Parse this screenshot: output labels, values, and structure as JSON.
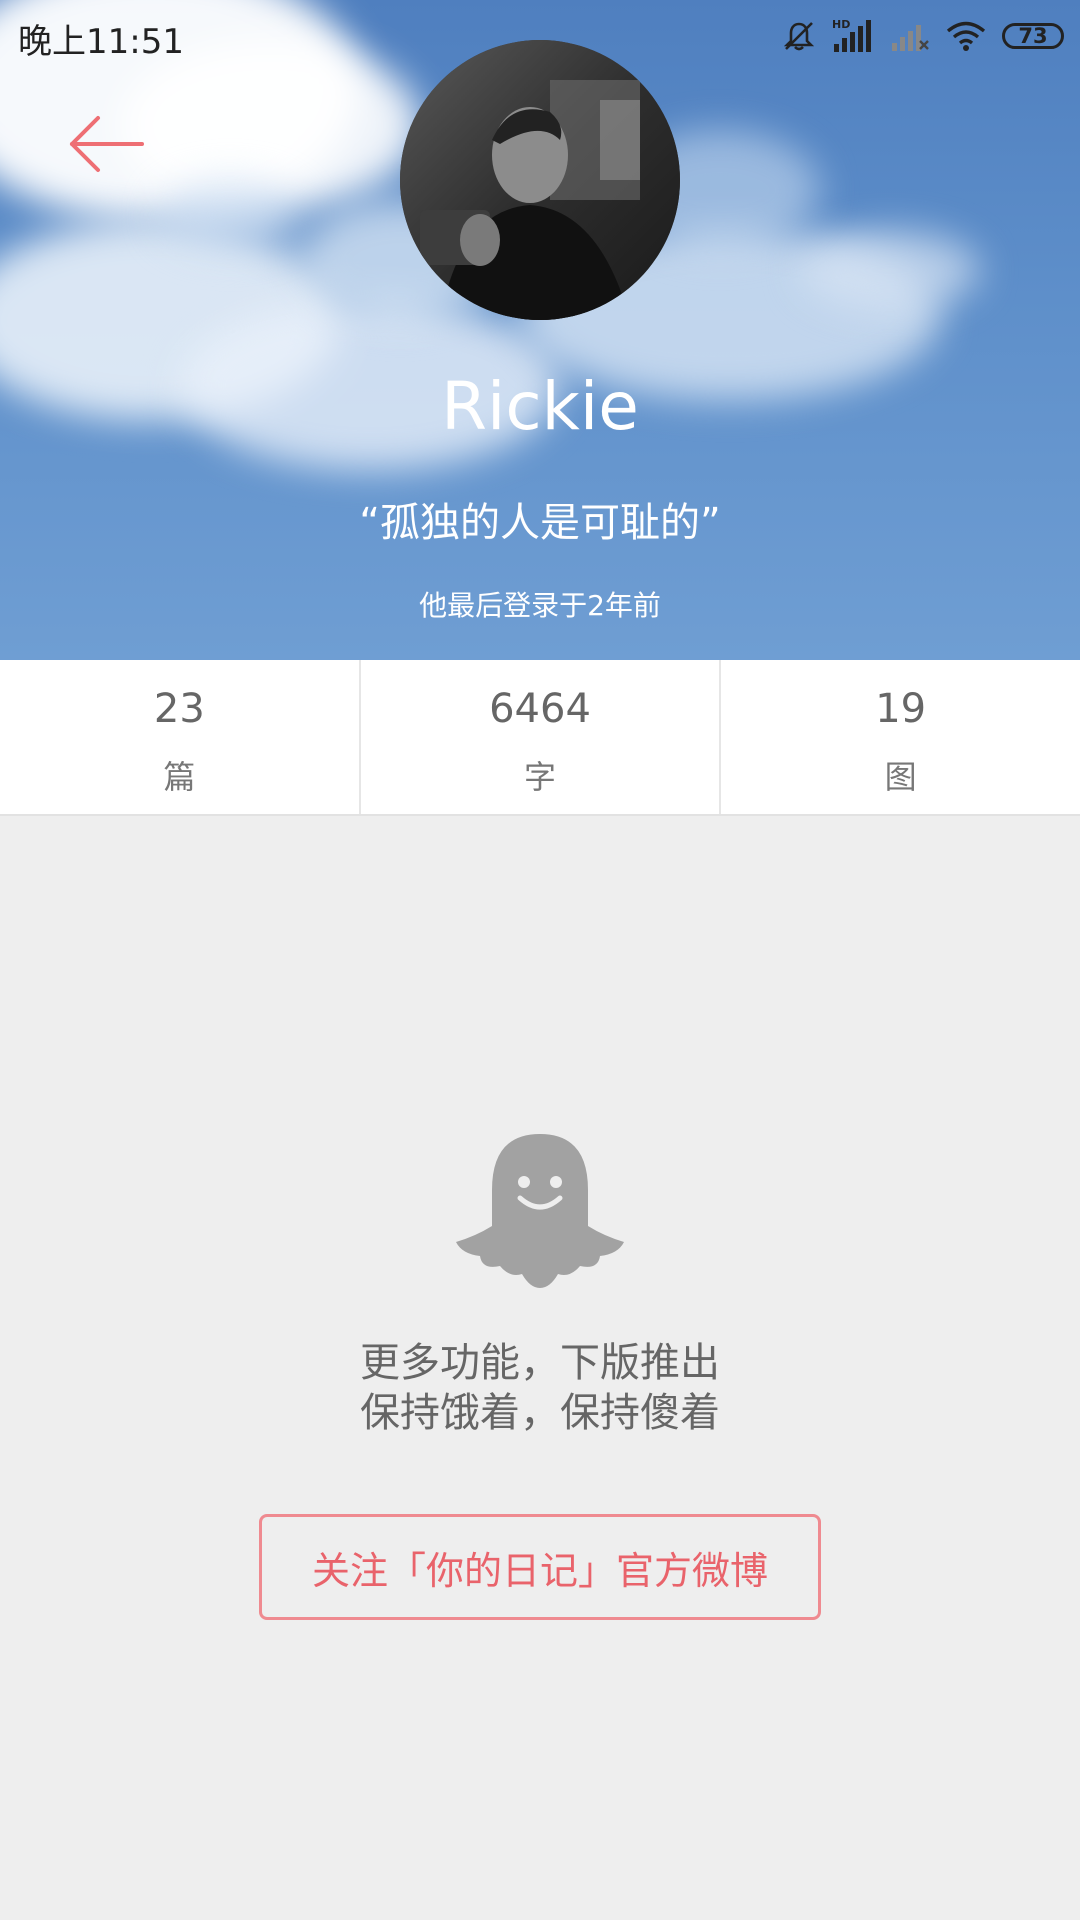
{
  "status_bar": {
    "time": "晚上11:51",
    "battery": "73",
    "icons": [
      "bell-muted-icon",
      "hd-signal-icon",
      "signal-off-icon",
      "wifi-icon",
      "battery-icon"
    ]
  },
  "header": {
    "back_icon": "arrow-left-icon",
    "username": "Rickie",
    "motto": "“孤独的人是可耻的”",
    "last_login": "他最后登录于2年前"
  },
  "stats": [
    {
      "value": "23",
      "label": "篇"
    },
    {
      "value": "6464",
      "label": "字"
    },
    {
      "value": "19",
      "label": "图"
    }
  ],
  "empty_state": {
    "icon": "ghost-icon",
    "line1": "更多功能，下版推出",
    "line2": "保持饿着，保持傻着"
  },
  "follow_button": {
    "label": "关注「你的日记」官方微博"
  },
  "colors": {
    "accent": "#e9636b",
    "background": "#eeeeee",
    "header_sky": "#5e8fca"
  }
}
